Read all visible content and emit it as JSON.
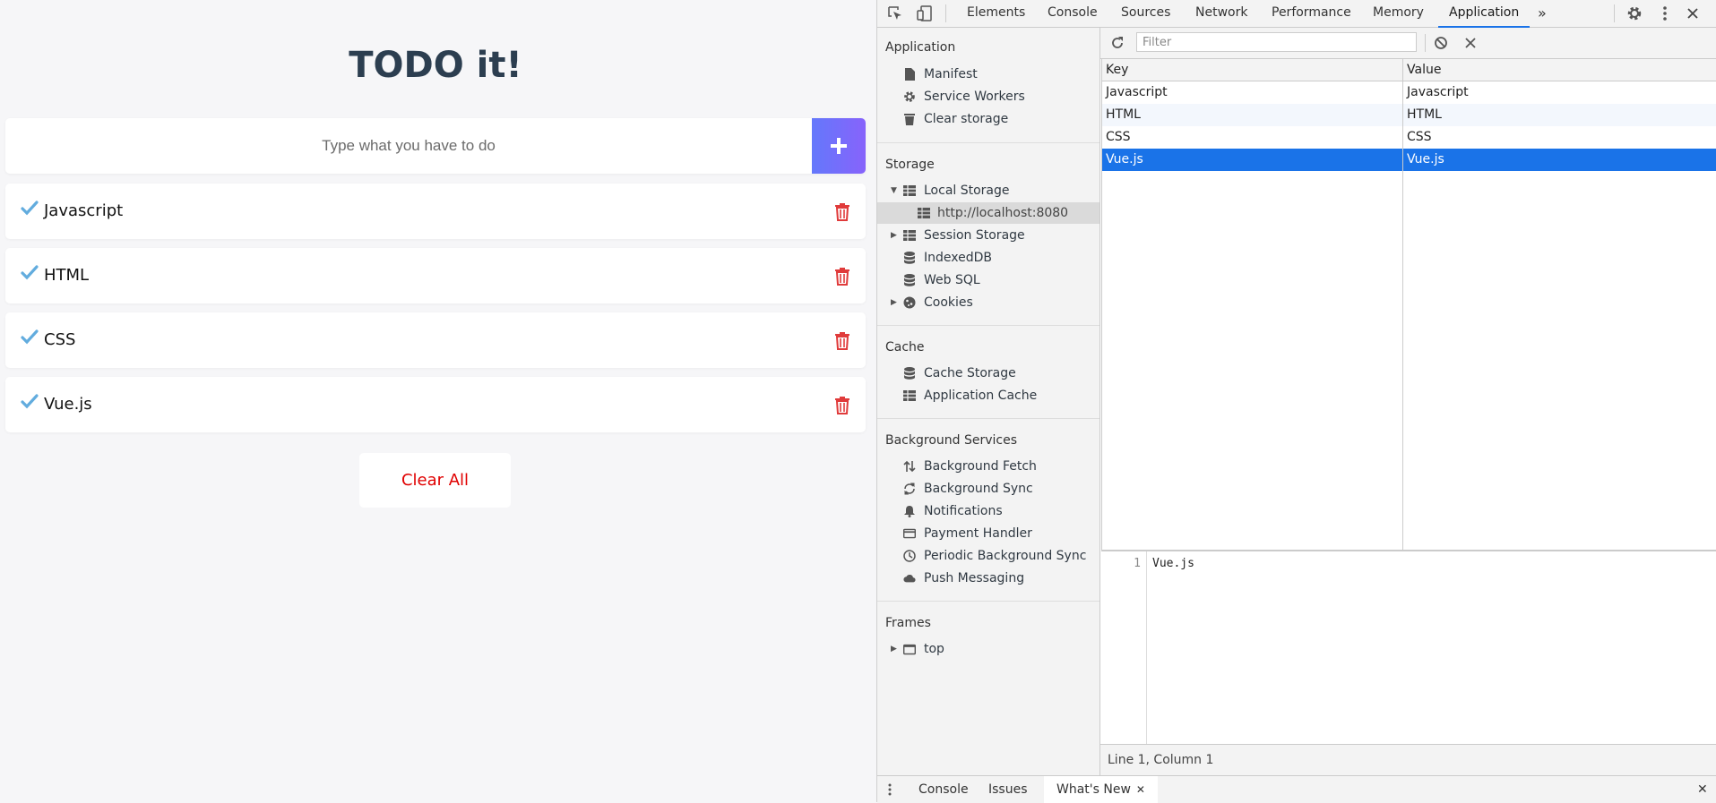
{
  "todo": {
    "title": "TODO it!",
    "input_placeholder": "Type what you have to do",
    "add_button_icon": "plus-icon",
    "items": [
      {
        "text": "Javascript",
        "completed": false
      },
      {
        "text": "HTML",
        "completed": false
      },
      {
        "text": "CSS",
        "completed": false
      },
      {
        "text": "Vue.js",
        "completed": false
      }
    ],
    "clear_all_label": "Clear All",
    "colors": {
      "check": "#62acde",
      "trash": "#e03b3b",
      "accent_start": "#6478fb",
      "accent_end": "#8763fb",
      "clear": "#e00000"
    }
  },
  "devtools": {
    "tabs": [
      "Elements",
      "Console",
      "Sources",
      "Network",
      "Performance",
      "Memory",
      "Application"
    ],
    "active_tab": "Application",
    "more_tabs": "»",
    "sidebar": {
      "application": {
        "header": "Application",
        "items": [
          "Manifest",
          "Service Workers",
          "Clear storage"
        ]
      },
      "storage": {
        "header": "Storage",
        "local_storage": "Local Storage",
        "local_storage_origin": "http://localhost:8080",
        "items": [
          "Session Storage",
          "IndexedDB",
          "Web SQL",
          "Cookies"
        ]
      },
      "cache": {
        "header": "Cache",
        "items": [
          "Cache Storage",
          "Application Cache"
        ]
      },
      "background": {
        "header": "Background Services",
        "items": [
          "Background Fetch",
          "Background Sync",
          "Notifications",
          "Payment Handler",
          "Periodic Background Sync",
          "Push Messaging"
        ]
      },
      "frames": {
        "header": "Frames",
        "items": [
          "top"
        ]
      }
    },
    "filter_placeholder": "Filter",
    "table": {
      "columns": [
        "Key",
        "Value"
      ],
      "rows": [
        {
          "key": "Javascript",
          "value": "Javascript"
        },
        {
          "key": "HTML",
          "value": "HTML"
        },
        {
          "key": "CSS",
          "value": "CSS"
        },
        {
          "key": "Vue.js",
          "value": "Vue.js"
        }
      ],
      "selected_row": 3
    },
    "preview": {
      "line_number": "1",
      "content": "Vue.js"
    },
    "status": "Line 1, Column 1",
    "drawer": {
      "tabs": [
        "Console",
        "Issues",
        "What's New"
      ],
      "active": "What's New"
    },
    "colors": {
      "accent": "#1a73e8"
    }
  }
}
